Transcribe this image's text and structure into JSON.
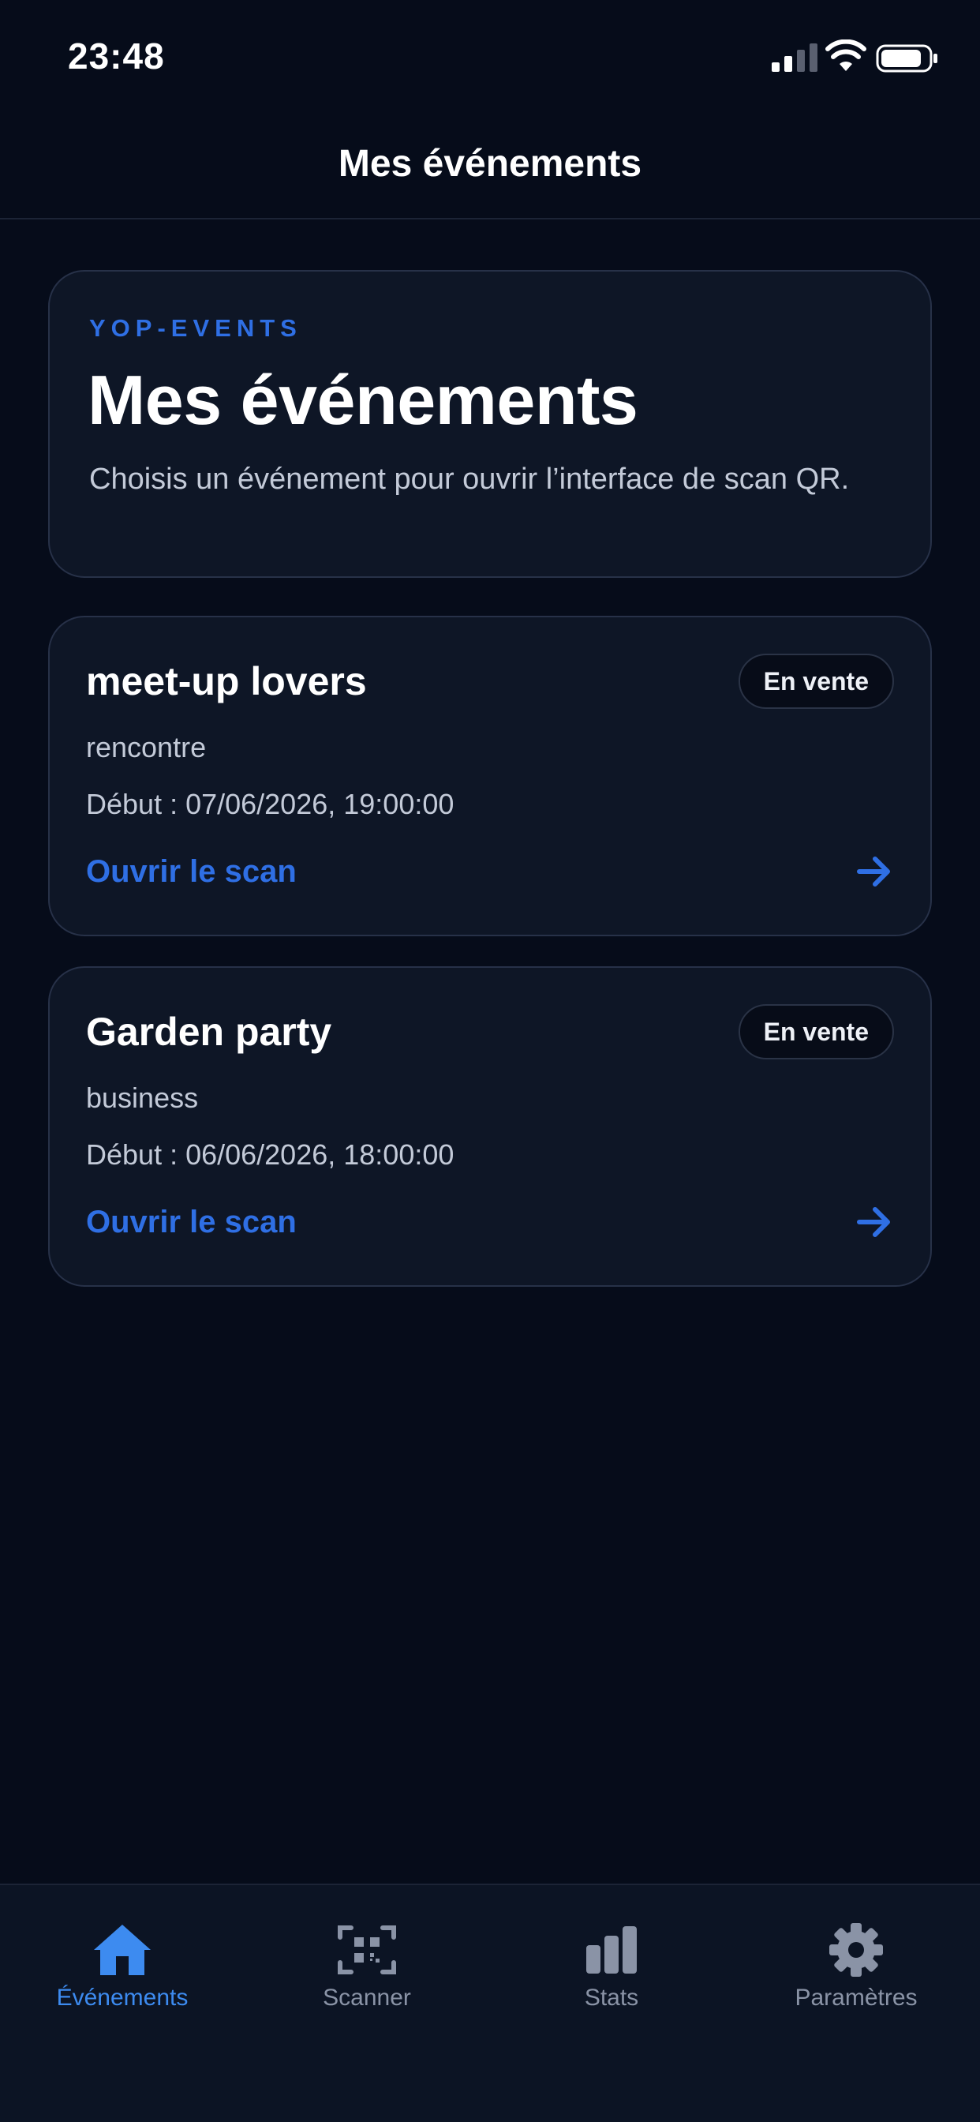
{
  "status_bar": {
    "time": "23:48",
    "signal_icon": "cellular-signal-icon",
    "wifi_icon": "wifi-icon",
    "battery_icon": "battery-icon"
  },
  "header": {
    "title": "Mes événements"
  },
  "hero": {
    "kicker": "YOP-EVENTS",
    "title": "Mes événements",
    "description": "Choisis un événement pour ouvrir l’interface de scan QR."
  },
  "events": [
    {
      "name": "meet-up lovers",
      "status": "En vente",
      "category": "rencontre",
      "start": "Début : 07/06/2026, 19:00:00",
      "action": "Ouvrir le scan",
      "action_icon": "arrow-right-icon"
    },
    {
      "name": "Garden party",
      "status": "En vente",
      "category": "business",
      "start": "Début : 06/06/2026, 18:00:00",
      "action": "Ouvrir le scan",
      "action_icon": "arrow-right-icon"
    }
  ],
  "tab_bar": {
    "tabs": [
      {
        "label": "Événements",
        "icon": "home-icon",
        "active": true
      },
      {
        "label": "Scanner",
        "icon": "qr-scan-icon",
        "active": false
      },
      {
        "label": "Stats",
        "icon": "bar-chart-icon",
        "active": false
      },
      {
        "label": "Paramètres",
        "icon": "gear-icon",
        "active": false
      }
    ]
  },
  "colors": {
    "background": "#060c1a",
    "card_background": "#0e1626",
    "card_border": "#273148",
    "accent": "#2f6fe4",
    "tab_active": "#3d8bf0",
    "tab_inactive": "#8a93a6",
    "muted_text": "#c3cad8"
  }
}
